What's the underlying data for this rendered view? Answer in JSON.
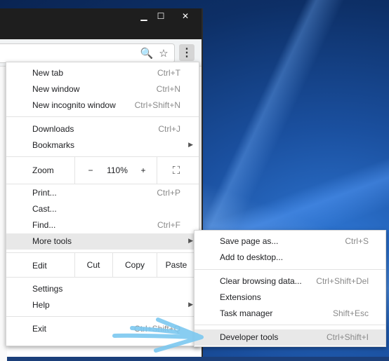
{
  "window": {
    "minimize": "▁",
    "maximize": "☐",
    "close": "✕"
  },
  "toolbar": {
    "zoom_icon": "🔍",
    "star_icon": "☆",
    "menu_icon": "⋮"
  },
  "menu": {
    "new_tab": {
      "label": "New tab",
      "shortcut": "Ctrl+T"
    },
    "new_window": {
      "label": "New window",
      "shortcut": "Ctrl+N"
    },
    "new_incognito": {
      "label": "New incognito window",
      "shortcut": "Ctrl+Shift+N"
    },
    "downloads": {
      "label": "Downloads",
      "shortcut": "Ctrl+J"
    },
    "bookmarks": {
      "label": "Bookmarks"
    },
    "zoom": {
      "label": "Zoom",
      "minus": "−",
      "value": "110%",
      "plus": "+",
      "fullscreen": "⛶"
    },
    "print": {
      "label": "Print...",
      "shortcut": "Ctrl+P"
    },
    "cast": {
      "label": "Cast..."
    },
    "find": {
      "label": "Find...",
      "shortcut": "Ctrl+F"
    },
    "more_tools": {
      "label": "More tools"
    },
    "edit": {
      "label": "Edit",
      "cut": "Cut",
      "copy": "Copy",
      "paste": "Paste"
    },
    "settings": {
      "label": "Settings"
    },
    "help": {
      "label": "Help"
    },
    "exit": {
      "label": "Exit",
      "shortcut": "Ctrl+Shift+Q"
    }
  },
  "submenu": {
    "save_page": {
      "label": "Save page as...",
      "shortcut": "Ctrl+S"
    },
    "add_desktop": {
      "label": "Add to desktop..."
    },
    "clear_data": {
      "label": "Clear browsing data...",
      "shortcut": "Ctrl+Shift+Del"
    },
    "extensions": {
      "label": "Extensions"
    },
    "task_manager": {
      "label": "Task manager",
      "shortcut": "Shift+Esc"
    },
    "dev_tools": {
      "label": "Developer tools",
      "shortcut": "Ctrl+Shift+I"
    }
  },
  "colors": {
    "annotation_arrow": "#7cc8f0",
    "highlight": "#e8e8e8"
  }
}
